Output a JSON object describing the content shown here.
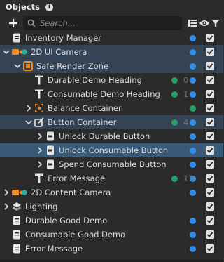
{
  "header": {
    "title": "Objects",
    "info_glyph": "i"
  },
  "search": {
    "placeholder": "Search...",
    "value": ""
  },
  "colors": {
    "selection_parent": "#344454",
    "selection_active": "#3a5a79",
    "blue_dot": "#2f8ee9",
    "green_dot": "#25a069"
  },
  "toolbar": {
    "icons": [
      "plus-icon",
      "search-icon",
      "sort-list-icon",
      "eye-icon",
      "filter-icon"
    ]
  },
  "rows": [
    {
      "label": "Inventory Manager",
      "icon": "scene-object-icon",
      "arrow": "none",
      "dots": [
        "blue"
      ],
      "checked": true
    },
    {
      "label": "2D UI Camera",
      "icon": "camera-icon",
      "arrow": "expanded",
      "dots": [
        "blue"
      ],
      "checked": true,
      "selected": "parent"
    },
    {
      "label": "Safe Render Zone",
      "icon": "render-zone-icon",
      "arrow": "expanded",
      "dots": [
        "blue"
      ],
      "checked": true,
      "selected": "parent"
    },
    {
      "label": "Durable Demo Heading",
      "icon": "text-icon",
      "arrow": "none",
      "dots": [
        "green",
        "blue"
      ],
      "count": "0",
      "checked": true
    },
    {
      "label": "Consumable Demo Heading",
      "icon": "text-icon",
      "arrow": "none",
      "dots": [
        "green",
        "blue"
      ],
      "count": "1",
      "checked": true
    },
    {
      "label": "Balance Container",
      "icon": "balance-container-icon",
      "arrow": "collapsed",
      "dots": [
        "green"
      ],
      "checked": true
    },
    {
      "label": "Button Container",
      "icon": "button-container-icon",
      "arrow": "expanded",
      "dots": [
        "green",
        "blue"
      ],
      "count": "4",
      "checked": true,
      "selected": "parent"
    },
    {
      "label": "Unlock Durable Button",
      "icon": "button-object-icon",
      "arrow": "collapsed",
      "dots": [
        "blue"
      ],
      "checked": true
    },
    {
      "label": "Unlock Consumable Button",
      "icon": "button-object-icon",
      "arrow": "collapsed",
      "dots": [
        "blue"
      ],
      "checked": true,
      "selected": "active"
    },
    {
      "label": "Spend Consumable Button",
      "icon": "button-object-icon",
      "arrow": "collapsed",
      "dots": [
        "blue"
      ],
      "checked": true
    },
    {
      "label": "Error Message",
      "icon": "text-icon",
      "arrow": "none",
      "dots": [
        "green",
        "blue"
      ],
      "count": "13",
      "checked": true
    },
    {
      "label": "2D Content Camera",
      "icon": "camera-icon",
      "arrow": "collapsed",
      "dots": [
        "blue"
      ],
      "checked": true
    },
    {
      "label": "Lighting",
      "icon": "lighting-icon",
      "arrow": "collapsed",
      "dots": [],
      "checked": true
    },
    {
      "label": "Durable Good Demo",
      "icon": "scene-object-icon",
      "arrow": "none",
      "dots": [
        "blue"
      ],
      "checked": true
    },
    {
      "label": "Consumable Good Demo",
      "icon": "scene-object-icon",
      "arrow": "none",
      "dots": [
        "blue"
      ],
      "checked": true
    },
    {
      "label": "Error Message",
      "icon": "scene-object-icon",
      "arrow": "none",
      "dots": [
        "blue"
      ],
      "checked": true
    }
  ]
}
